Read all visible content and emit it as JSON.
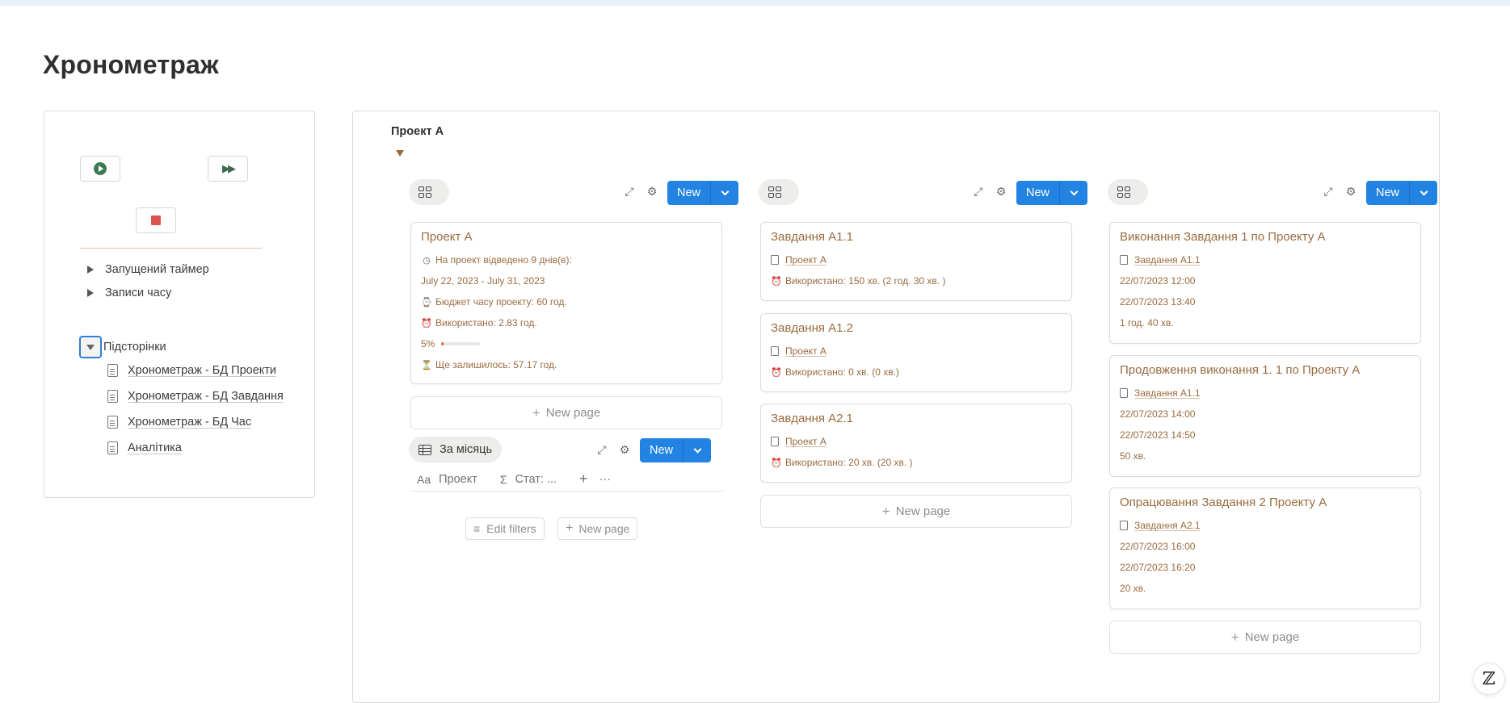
{
  "page": {
    "title": "Хронометраж"
  },
  "left_panel": {
    "play_icon": "play-circle-icon",
    "skip_icon": "fast-forward-icon",
    "stop_icon": "stop-square-icon",
    "toggles": [
      {
        "label": "Запущений таймер"
      },
      {
        "label": "Записи часу"
      }
    ],
    "subpages_label": "Підсторінки",
    "subpages": [
      {
        "label": "Хронометраж - БД Проекти"
      },
      {
        "label": "Хронометраж - БД Завдання"
      },
      {
        "label": "Хронометраж - БД Час"
      },
      {
        "label": "Аналітика"
      }
    ]
  },
  "right_panel": {
    "title": "Проект А",
    "new_label": "New",
    "new_page_label": "New page",
    "projects": {
      "card": {
        "title": "Проект А",
        "allotted": "На проект відведено  9 днів(в):",
        "dates": "July 22, 2023 - July 31, 2023",
        "budget": "Бюджет часу проекту: 60 год.",
        "used": "Використано: 2.83 год.",
        "progress_text": "5%",
        "progress_value": 5,
        "remaining": "Ще залишилось: 57.17 год."
      }
    },
    "table_view": {
      "label": "За місяць",
      "col_project": "Проект",
      "col_stat": "Стат: ...",
      "edit_filters": "Edit filters",
      "new_page": "New page"
    },
    "tasks": [
      {
        "title": "Завдання А1.1",
        "project": "Проект А",
        "used": "Використано: 150 хв. (2 год. 30 хв. )"
      },
      {
        "title": "Завдання А1.2",
        "project": "Проект А",
        "used": "Використано: 0 хв. (0 хв.)"
      },
      {
        "title": "Завдання А2.1",
        "project": "Проект А",
        "used": "Використано: 20 хв. (20 хв. )"
      }
    ],
    "time_entries": [
      {
        "title": "Виконання Завдання 1 по Проекту А",
        "task": "Завдання А1.1",
        "start": "22/07/2023 12:00",
        "end": "22/07/2023 13:40",
        "duration": "1 год. 40 хв."
      },
      {
        "title": "Продовження виконання 1. 1 по Проекту А",
        "task": "Завдання А1.1",
        "start": "22/07/2023 14:00",
        "end": "22/07/2023 14:50",
        "duration": "50 хв."
      },
      {
        "title": "Опрацювання Завдання 2 Проекту А",
        "task": "Завдання А2.1",
        "start": "22/07/2023 16:00",
        "end": "22/07/2023 16:20",
        "duration": "20 хв."
      }
    ]
  },
  "help": {
    "icon": "help-icon",
    "glyph": "ℤ"
  }
}
